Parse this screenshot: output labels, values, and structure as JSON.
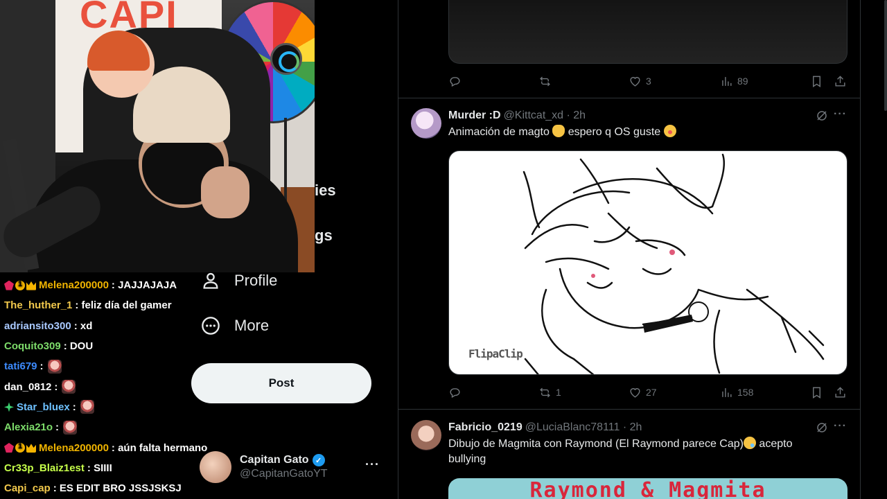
{
  "nav": {
    "fragment_communities": "ies",
    "fragment_settings": "gs",
    "profile_label": "Profile",
    "more_label": "More",
    "post_button": "Post"
  },
  "account": {
    "display_name": "Capitan Gato",
    "handle": "@CapitanGatoYT",
    "verified": true
  },
  "webcam": {
    "banner_text": "CAPI"
  },
  "chat": [
    {
      "user": "Melena200000",
      "color": "#f0b400",
      "badges": [
        "gem",
        "coin",
        "crown"
      ],
      "message": ": JAJJAJAJA",
      "emote": false
    },
    {
      "user": "The_huther_1",
      "color": "#f2c94c",
      "badges": [],
      "message": ": feliz día del gamer",
      "emote": false
    },
    {
      "user": "adriansito300",
      "color": "#a9c9ff",
      "badges": [],
      "message": ": xd",
      "emote": false
    },
    {
      "user": "Coquito309",
      "color": "#7ddc6a",
      "badges": [],
      "message": ": DOU",
      "emote": false
    },
    {
      "user": "tati679",
      "color": "#3d8bff",
      "badges": [],
      "message": ":",
      "emote": true
    },
    {
      "user": "dan_0812",
      "color": "#ffffff",
      "badges": [],
      "message": ":",
      "emote": true
    },
    {
      "user": "Star_bluex",
      "color": "#6ec1ff",
      "badges": [
        "star"
      ],
      "message": ":",
      "emote": true
    },
    {
      "user": "Alexia21o",
      "color": "#7ddc6a",
      "badges": [],
      "message": ":",
      "emote": true
    },
    {
      "user": "Melena200000",
      "color": "#f0b400",
      "badges": [
        "gem",
        "coin",
        "crown"
      ],
      "message": ": aún falta hermano",
      "emote": false
    },
    {
      "user": "Cr33p_Blaiz1est",
      "color": "#c6ff4a",
      "badges": [],
      "message": ": SIIII",
      "emote": false
    },
    {
      "user": "Capi_cap",
      "color": "#f2c94c",
      "badges": [],
      "message": ": ES EDIT BRO JSSJSKSJ",
      "emote": false
    }
  ],
  "feed": {
    "top_actions": {
      "replies": "",
      "retweets": "",
      "likes": "3",
      "views": "89"
    },
    "tweets": [
      {
        "name": "Murder :D",
        "handle": "@Kittcat_xd",
        "time": "2h",
        "text_before": "Animación de magto",
        "text_mid": " espero q OS guste",
        "media_watermark": "FlipaClip",
        "actions": {
          "replies": "",
          "retweets": "1",
          "likes": "27",
          "views": "158"
        }
      },
      {
        "name": "Fabricio_0219",
        "handle": "@LuciaBlanc78111",
        "time": "2h",
        "text_line1": "Dibujo de Magmita con Raymond (El Raymond parece Cap)",
        "text_line1_end": " acepto",
        "text_line2": "bullying",
        "media_title": "Raymond & Magmita"
      }
    ]
  }
}
